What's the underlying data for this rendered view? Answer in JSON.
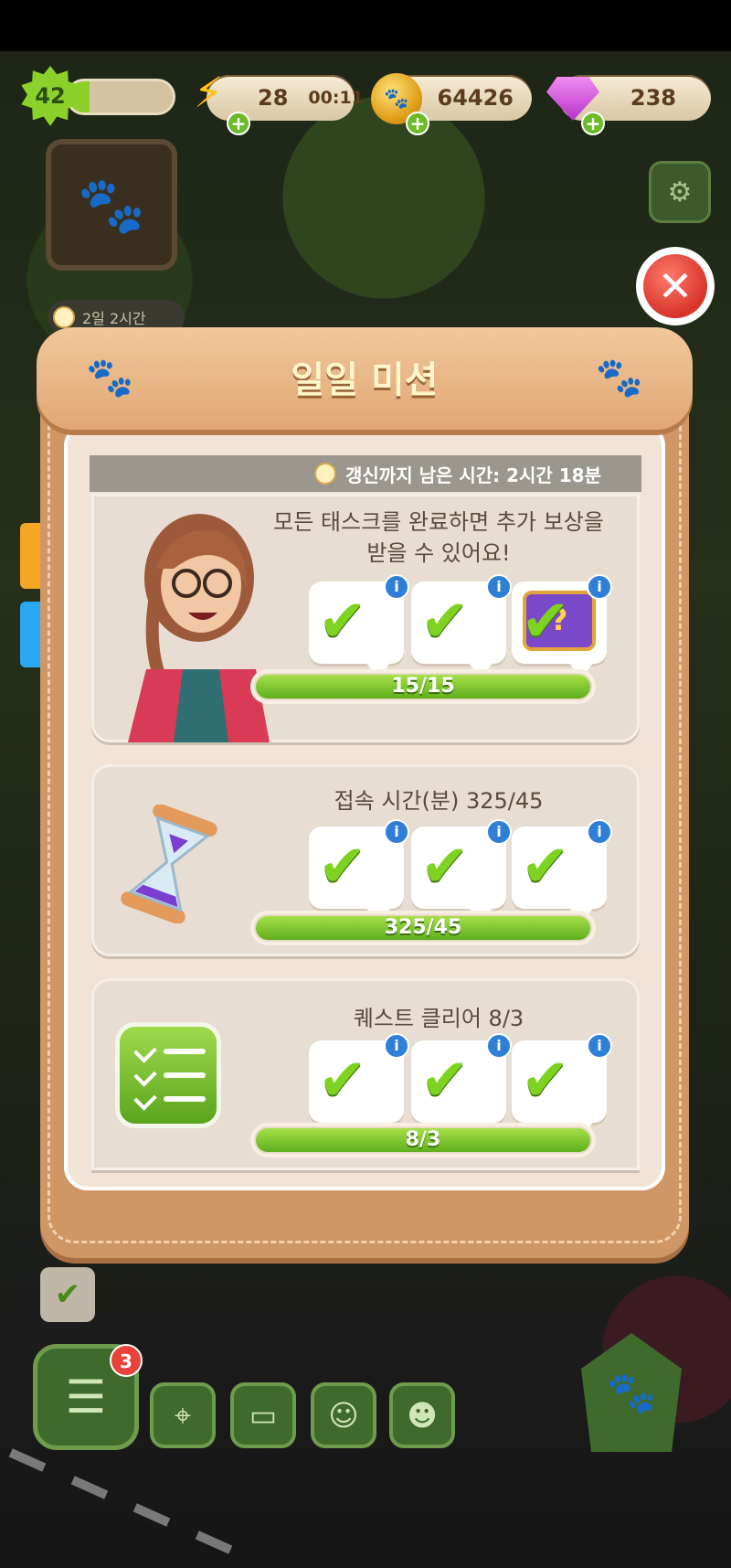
{
  "hud": {
    "level": "42",
    "xp_fraction": 0.2,
    "energy": "28",
    "energy_timer": "00:11",
    "coins": "64426",
    "gems": "238"
  },
  "background": {
    "timer_chip": "2일 2시간"
  },
  "panel": {
    "title": "일일 미션",
    "refresh_text": "갱신까지 남은 시간: 2시간 18분"
  },
  "missions": [
    {
      "title": "모든 태스크를 완료하면 추가 보상을\n받을 수 있어요!",
      "progress_text": "15/15",
      "progress_fraction": 1.0,
      "rewards": [
        "check",
        "check",
        "check"
      ]
    },
    {
      "title": "접속 시간(분) 325/45",
      "progress_text": "325/45",
      "progress_fraction": 1.0,
      "rewards": [
        "check",
        "check",
        "check"
      ]
    },
    {
      "title": "퀘스트 클리어 8/3",
      "progress_text": "8/3",
      "progress_fraction": 1.0,
      "rewards": [
        "check",
        "check",
        "check"
      ]
    }
  ],
  "bottom_bar": {
    "quest_badge": "3"
  },
  "icons": {
    "close": "close-icon",
    "info": "info-icon",
    "check": "checkmark-icon",
    "paw": "paw-icon"
  },
  "colors": {
    "panel_border": "#cf9766",
    "progress_green": "#7ed321",
    "info_blue": "#2f7fd6",
    "close_red": "#d8342b"
  }
}
